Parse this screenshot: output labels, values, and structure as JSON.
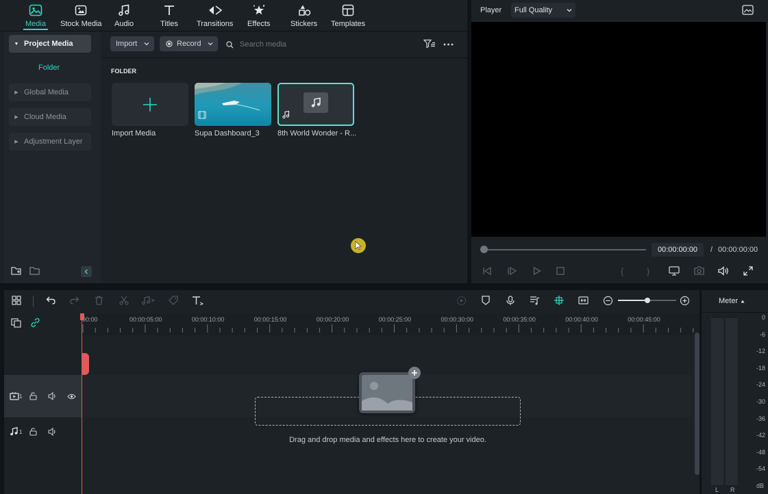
{
  "toolbar": {
    "tabs": [
      {
        "label": "Media",
        "icon": "media-icon",
        "active": true
      },
      {
        "label": "Stock Media",
        "icon": "stock-media-icon"
      },
      {
        "label": "Audio",
        "icon": "music-note-icon"
      },
      {
        "label": "Titles",
        "icon": "titles-icon"
      },
      {
        "label": "Transitions",
        "icon": "transitions-icon"
      },
      {
        "label": "Effects",
        "icon": "effects-icon"
      },
      {
        "label": "Stickers",
        "icon": "stickers-icon"
      },
      {
        "label": "Templates",
        "icon": "templates-icon"
      }
    ]
  },
  "sidebar": {
    "project_media": "Project Media",
    "folder": "Folder",
    "items": [
      "Global Media",
      "Cloud Media",
      "Adjustment Layer"
    ]
  },
  "media": {
    "import_label": "Import",
    "record_label": "Record",
    "search_placeholder": "Search media",
    "section_title": "FOLDER",
    "cards": [
      {
        "name": "Import Media",
        "type": "import"
      },
      {
        "name": "Supa Dashboard_3",
        "type": "video"
      },
      {
        "name": "8th World Wonder - R...",
        "type": "audio"
      }
    ]
  },
  "player": {
    "label": "Player",
    "quality": "Full Quality",
    "current_time": "00:00:00:00",
    "separator": "/",
    "total_time": "00:00:00:00",
    "progress": 0
  },
  "timeline": {
    "ticks": [
      "00:00",
      "00:00:05:00",
      "00:00:10:00",
      "00:00:15:00",
      "00:00:20:00",
      "00:00:25:00",
      "00:00:30:00",
      "00:00:35:00",
      "00:00:40:00",
      "00:00:45:00"
    ],
    "video_track_num": "1",
    "audio_track_num": "1",
    "drop_hint": "Drag and drop media and effects here to create your video.",
    "zoom_level": 0.75
  },
  "meter": {
    "label": "Meter",
    "db_scale": [
      "0",
      "-6",
      "-12",
      "-18",
      "-24",
      "-30",
      "-36",
      "-42",
      "-48",
      "-54",
      "dB"
    ],
    "channels": [
      "L",
      "R"
    ]
  },
  "colors": {
    "accent": "#2bd9bf",
    "playhead": "#e05a5a",
    "cursor": "#c9b325"
  }
}
